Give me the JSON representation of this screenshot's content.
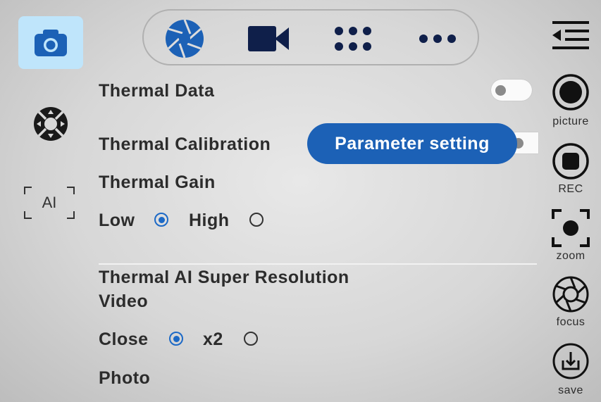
{
  "modes": {
    "items": [
      {
        "name": "aperture-icon"
      },
      {
        "name": "video-camera-icon"
      },
      {
        "name": "grid-icon"
      },
      {
        "name": "more-icon"
      }
    ]
  },
  "left_sidebar": {
    "camera_icon": "camera-icon",
    "dpad_icon": "dpad-icon",
    "ai_label": "AI"
  },
  "settings": {
    "thermal_data": "Thermal Data",
    "thermal_calibration": "Thermal Calibration",
    "parameter_setting": "Parameter setting",
    "thermal_gain": "Thermal Gain",
    "gain_low": "Low",
    "gain_high": "High",
    "super_res": "Thermal AI Super Resolution",
    "video": "Video",
    "video_close": "Close",
    "video_x2": "x2",
    "photo": "Photo"
  },
  "right_sidebar": {
    "picture": "picture",
    "rec": "REC",
    "zoom": "zoom",
    "focus": "focus",
    "save": "save"
  },
  "state": {
    "thermal_data_on": false,
    "thermal_calibration_on": false,
    "gain_selected": "Low",
    "video_selected": "Close"
  },
  "colors": {
    "accent": "#1c61b6",
    "icon_dark": "#0f1f4a",
    "tile_bg": "#bfe5fb"
  }
}
